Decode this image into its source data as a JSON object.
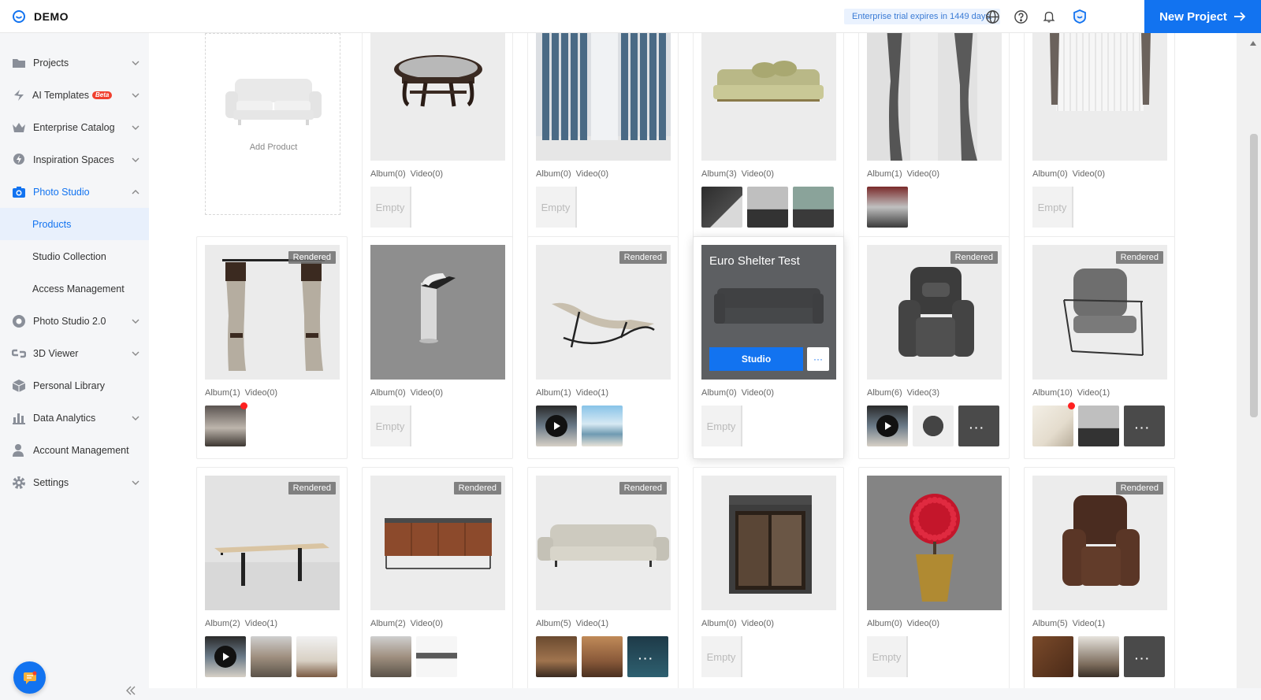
{
  "app": {
    "brand": "DEMO",
    "trial": "Enterprise trial expires in 1449 days.",
    "new_project": "New Project"
  },
  "colors": {
    "accent": "#1273f0",
    "badge_red": "#f0402f"
  },
  "sidebar": {
    "items": [
      {
        "label": "Projects",
        "icon": "folder-icon",
        "has_chevron": true
      },
      {
        "label": "AI Templates",
        "badge": "Beta",
        "icon": "lightning-icon",
        "has_chevron": true
      },
      {
        "label": "Enterprise Catalog",
        "icon": "crown-icon",
        "has_chevron": true
      },
      {
        "label": "Inspiration Spaces",
        "icon": "bulb-icon",
        "has_chevron": true
      },
      {
        "label": "Photo Studio",
        "icon": "camera-icon",
        "has_chevron": true,
        "open": true
      },
      {
        "label": "Products",
        "sub": true,
        "active": true
      },
      {
        "label": "Studio Collection",
        "sub": true
      },
      {
        "label": "Access Management",
        "sub": true
      },
      {
        "label": "Photo Studio 2.0",
        "icon": "aperture-icon",
        "has_chevron": true
      },
      {
        "label": "3D Viewer",
        "icon": "link-icon",
        "has_chevron": true
      },
      {
        "label": "Personal Library",
        "icon": "box-icon",
        "has_chevron": false
      },
      {
        "label": "Data Analytics",
        "icon": "bar-chart-icon",
        "has_chevron": true
      },
      {
        "label": "Account Management",
        "icon": "user-icon",
        "has_chevron": false
      },
      {
        "label": "Settings",
        "icon": "gear-icon",
        "has_chevron": true
      }
    ]
  },
  "add_product": {
    "label": "Add Product"
  },
  "card_texts": {
    "album_fmt": "Album",
    "video_fmt": "Video",
    "empty": "Empty",
    "rendered": "Rendered",
    "studio": "Studio",
    "more": "···"
  },
  "hover_card": {
    "title": "Euro Shelter Test"
  },
  "products": [
    {
      "row": 0,
      "col": 1,
      "album": "Album(0)",
      "video": "Video(0)",
      "subject": "table",
      "minis": []
    },
    {
      "row": 0,
      "col": 2,
      "album": "Album(0)",
      "video": "Video(0)",
      "subject": "curtain-blue",
      "minis": []
    },
    {
      "row": 0,
      "col": 3,
      "album": "Album(3)",
      "video": "Video(0)",
      "subject": "sofa-green",
      "minis": [
        "room-dark",
        "room-gray",
        "room-green"
      ]
    },
    {
      "row": 0,
      "col": 4,
      "album": "Album(1)",
      "video": "Video(0)",
      "subject": "curtain-gray",
      "minis": [
        "room-red"
      ]
    },
    {
      "row": 0,
      "col": 5,
      "album": "Album(0)",
      "video": "Video(0)",
      "subject": "curtain-sheer",
      "minis": []
    },
    {
      "row": 1,
      "col": 0,
      "album": "Album(1)",
      "video": "Video(0)",
      "subject": "curtain-rod",
      "rendered": true,
      "minis": [
        "bedroom"
      ],
      "reddot": true
    },
    {
      "row": 1,
      "col": 1,
      "album": "Album(0)",
      "video": "Video(0)",
      "subject": "faucet",
      "minis": []
    },
    {
      "row": 1,
      "col": 2,
      "album": "Album(1)",
      "video": "Video(1)",
      "subject": "rocking-chair",
      "rendered": true,
      "minis": [
        "video",
        "patio"
      ]
    },
    {
      "row": 1,
      "col": 3,
      "album": "Album(0)",
      "video": "Video(0)",
      "subject": "sofa-dark",
      "hover": true,
      "minis": []
    },
    {
      "row": 1,
      "col": 4,
      "album": "Album(6)",
      "video": "Video(3)",
      "subject": "recliner-dark",
      "rendered": true,
      "minis": [
        "video",
        "recliner",
        "more-dark"
      ]
    },
    {
      "row": 1,
      "col": 5,
      "album": "Album(10)",
      "video": "Video(1)",
      "subject": "armchair",
      "rendered": true,
      "minis": [
        "room-light",
        "room-gray",
        "more-dark"
      ],
      "reddot": true
    },
    {
      "row": 2,
      "col": 0,
      "album": "Album(2)",
      "video": "Video(1)",
      "subject": "desk",
      "rendered": true,
      "minis": [
        "video",
        "living",
        "office"
      ]
    },
    {
      "row": 2,
      "col": 1,
      "album": "Album(2)",
      "video": "Video(0)",
      "subject": "sideboard",
      "rendered": true,
      "minis": [
        "living",
        "sideboard"
      ]
    },
    {
      "row": 2,
      "col": 2,
      "album": "Album(5)",
      "video": "Video(1)",
      "subject": "sofa-beige",
      "rendered": true,
      "minis": [
        "wood-room",
        "wood-room2",
        "more-teal"
      ]
    },
    {
      "row": 2,
      "col": 3,
      "album": "Album(0)",
      "video": "Video(0)",
      "subject": "booth",
      "minis": []
    },
    {
      "row": 2,
      "col": 4,
      "album": "Album(0)",
      "video": "Video(0)",
      "subject": "plant",
      "minis": []
    },
    {
      "row": 2,
      "col": 5,
      "album": "Album(5)",
      "video": "Video(1)",
      "subject": "recliner-brown",
      "rendered": true,
      "minis": [
        "leather",
        "living2",
        "more-dark"
      ]
    }
  ]
}
